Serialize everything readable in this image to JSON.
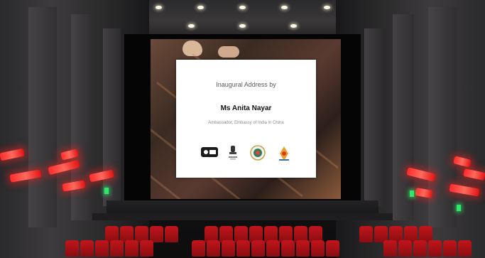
{
  "slide": {
    "heading": "Inaugural Address by",
    "speaker_name": "Ms Anita Nayar",
    "speaker_role": "Ambassador, Embassy of India in China",
    "logos": [
      "lion-emblem-logo",
      "state-emblem-logo",
      "seal-logo",
      "festival-logo"
    ]
  },
  "colors": {
    "seat_red": "#c1151a",
    "sconce_red": "#ff2a2a",
    "exit_green": "#2ee86a",
    "slide_bg": "#ffffff"
  }
}
